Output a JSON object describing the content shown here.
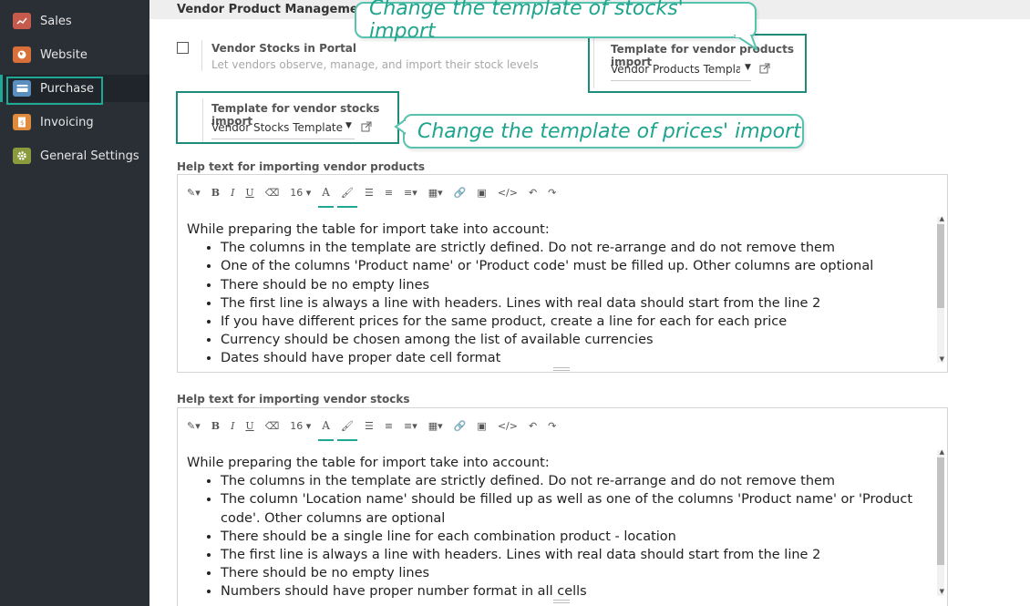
{
  "sidebar": {
    "items": [
      {
        "label": "Sales",
        "icon": "sales-chart-icon",
        "color": "#d46a5a"
      },
      {
        "label": "Website",
        "icon": "globe-icon",
        "color": "#e0763c"
      },
      {
        "label": "Purchase",
        "icon": "credit-card-icon",
        "color": "#5a8fbf"
      },
      {
        "label": "Invoicing",
        "icon": "invoice-icon",
        "color": "#e08a3c"
      },
      {
        "label": "General Settings",
        "icon": "gear-icon",
        "color": "#8a9a3c"
      }
    ],
    "active_item": "Purchase"
  },
  "section": {
    "title": "Vendor Product Management"
  },
  "vendor_stocks_portal": {
    "label": "Vendor Stocks in Portal",
    "description": "Let vendors observe, manage, and import their stock levels",
    "checked": false
  },
  "products_template": {
    "label": "Template for vendor products import",
    "value": "Vendor Products Template"
  },
  "stocks_template": {
    "label": "Template for vendor stocks import",
    "value": "Vendor Stocks Template"
  },
  "callouts": {
    "stocks": "Change the template of stocks' import",
    "prices": "Change the template of prices' import"
  },
  "toolbar": {
    "font_size": "16"
  },
  "help_products": {
    "label": "Help text for importing vendor products",
    "intro": "While preparing the table for import take into account:",
    "bullets": [
      "The columns in the template are strictly defined. Do not re-arrange and do not remove them",
      "One of the columns 'Product name' or 'Product code' must be filled up. Other columns are optional",
      "There should be no empty lines",
      "The first line is always a line with headers. Lines with real data should start from the line 2",
      "If you have different prices for the same product, create a line for each for each price",
      "Currency should be chosen among the list of available currencies",
      "Dates should have proper date cell format"
    ]
  },
  "help_stocks": {
    "label": "Help text for importing vendor stocks",
    "intro": "While preparing the table for import take into account:",
    "bullets": [
      "The columns in the template are strictly defined. Do not re-arrange and do not remove them",
      "The column 'Location name' should be filled up as well as one of the columns 'Product name' or 'Product code'. Other columns are optional",
      "There should be a single line for each combination product - location",
      "The first line is always a line with headers. Lines with real data should start from the line 2",
      "There should be no empty lines",
      "Numbers should have proper number format in all cells"
    ]
  },
  "colors": {
    "accent": "#1ea896",
    "callout_border": "#57c3ae",
    "sidebar_bg": "#2a2f36"
  }
}
